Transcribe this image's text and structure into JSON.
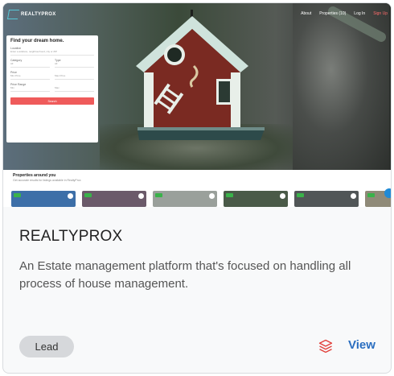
{
  "card": {
    "title": "REALTYPROX",
    "description": "An Estate management platform that's focused on handling all process of house management.",
    "badge": "Lead",
    "view_label": "View",
    "accent_color": "#2a6ec0",
    "icon_color": "#e2403a"
  },
  "preview": {
    "logo_text": "REALTYPROX",
    "nav": [
      "About",
      "Properties (10)",
      "Log In",
      "Sign Up"
    ],
    "search": {
      "title": "Find your dream home.",
      "location_label": "Location",
      "location_placeholder": "Enter a address, neighbourhood, city or ZIP",
      "category_label": "Category",
      "category_value": "All",
      "type_label": "Type",
      "type_value": "All",
      "price_label": "Price",
      "price_min": "Min Price",
      "price_max": "Max Price",
      "price_range_label": "Price Range",
      "price_from": "Min",
      "price_to": "Max",
      "button": "Search"
    },
    "properties_title": "Properties around you",
    "properties_subtitle": "Get accurate results for listings available in RealtyProx",
    "thumb_colors": [
      "#3d6fa8",
      "#6b5a6a",
      "#9aa09b",
      "#4a5a48",
      "#515657",
      "#8f8a78"
    ]
  }
}
